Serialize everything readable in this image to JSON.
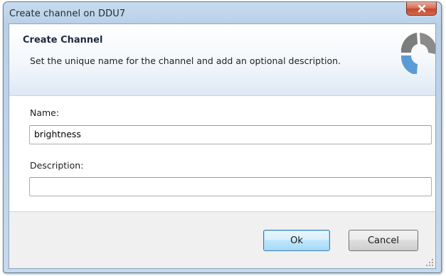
{
  "window": {
    "title": "Create channel on DDU7"
  },
  "header": {
    "title": "Create Channel",
    "subtitle": "Set the unique name for the channel and add an optional description."
  },
  "form": {
    "name_label": "Name:",
    "name_value": "brightness",
    "description_label": "Description:",
    "description_value": ""
  },
  "buttons": {
    "ok_label": "Ok",
    "cancel_label": "Cancel"
  },
  "icons": {
    "close": "close-icon",
    "logo": "wizard-logo-icon",
    "grip": "resize-grip-icon"
  },
  "colors": {
    "title_bar": "#c8dcef",
    "close_button": "#c44a2f",
    "default_button_border": "#3c7fb1",
    "logo_gray": "#7c7c7c",
    "logo_blue": "#5b9bd5"
  }
}
